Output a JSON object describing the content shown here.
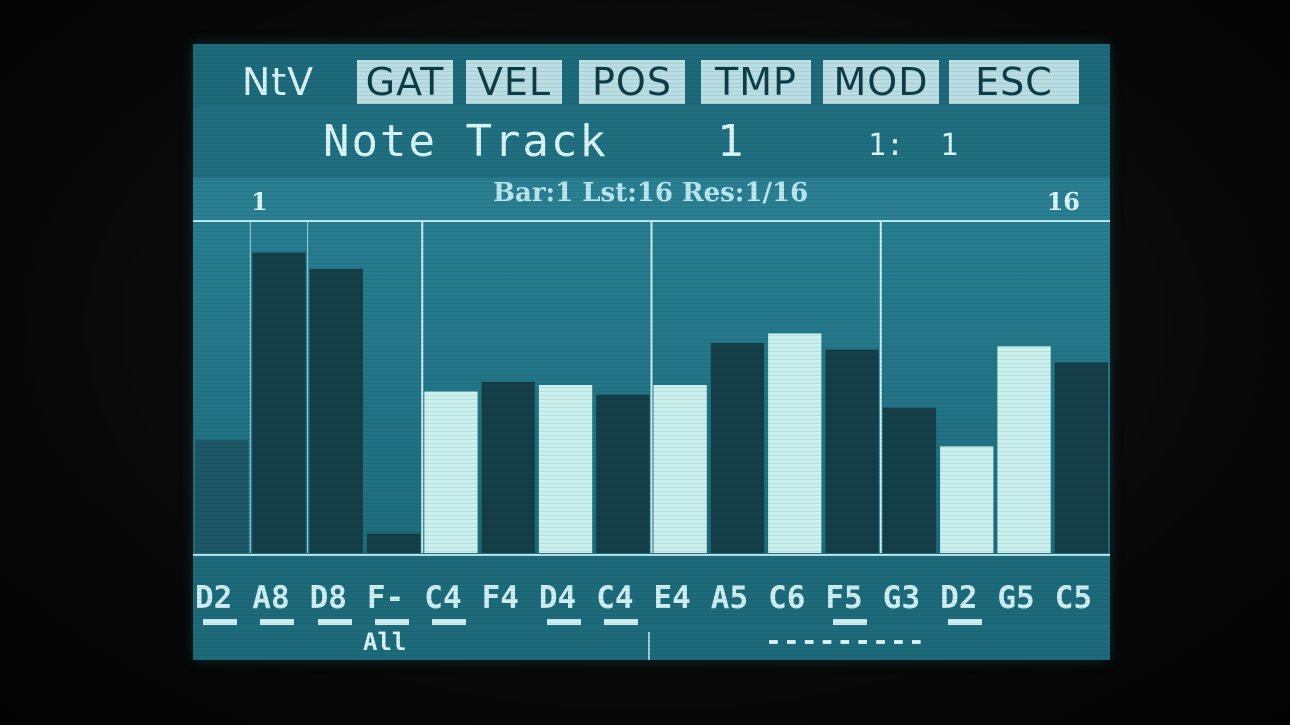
{
  "menu": {
    "items": [
      {
        "label": "NtV",
        "boxed": false
      },
      {
        "label": "GAT",
        "boxed": true
      },
      {
        "label": "VEL",
        "boxed": true
      },
      {
        "label": "POS",
        "boxed": true
      },
      {
        "label": "TMP",
        "boxed": true
      },
      {
        "label": "MOD",
        "boxed": true
      },
      {
        "label": "ESC",
        "boxed": true
      }
    ]
  },
  "title": {
    "text": "Note Track",
    "track_number": "1",
    "position": "1:  1"
  },
  "info": {
    "start_step": "1",
    "end_step": "16",
    "details": "Bar:1 Lst:16 Res:1/16"
  },
  "chart_data": {
    "type": "bar",
    "categories": [
      "D2",
      "A8",
      "D8",
      "F-",
      "C4",
      "F4",
      "D4",
      "C4",
      "E4",
      "A5",
      "C6",
      "F5",
      "G3",
      "D2",
      "G5",
      "C5"
    ],
    "values": [
      35,
      93,
      88,
      6,
      50,
      53,
      52,
      49,
      52,
      65,
      68,
      63,
      45,
      33,
      64,
      59
    ],
    "ylim": [
      0,
      100
    ],
    "highlighted": [
      false,
      false,
      false,
      false,
      true,
      false,
      true,
      false,
      true,
      false,
      true,
      false,
      false,
      true,
      true,
      false
    ],
    "bar_divisions": 4,
    "colors": {
      "dark": "#153f48",
      "light": "#c9f0ec",
      "first_bar": "#1e5866"
    }
  },
  "notes": {
    "labels": [
      "D2",
      "A8",
      "D8",
      "F-",
      "C4",
      "F4",
      "D4",
      "C4",
      "E4",
      "A5",
      "C6",
      "F5",
      "G3",
      "D2",
      "G5",
      "C5"
    ],
    "underlined": [
      true,
      true,
      true,
      true,
      true,
      false,
      true,
      true,
      false,
      false,
      false,
      true,
      false,
      true,
      false,
      false
    ]
  },
  "bottom": {
    "left": "All",
    "right": "---------"
  }
}
